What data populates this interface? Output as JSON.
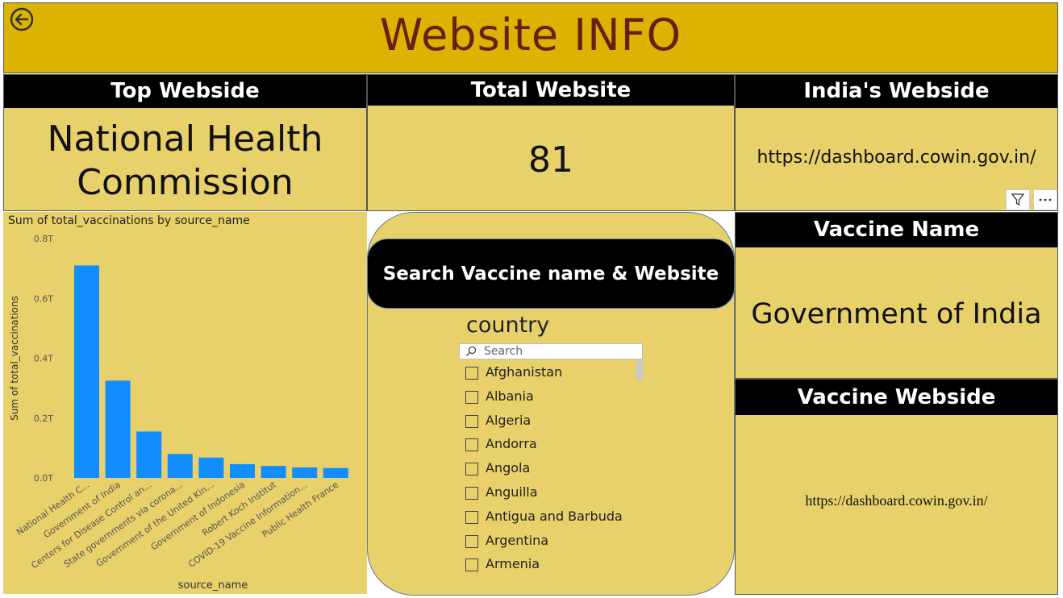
{
  "header": {
    "title": "Website INFO",
    "back_icon": "back-arrow-icon"
  },
  "cards": {
    "top_website": {
      "title": "Top Webside",
      "value_line1": "National Health",
      "value_line2": "Commission"
    },
    "total_website": {
      "title": "Total Website",
      "value": "81"
    },
    "india_website": {
      "title": "India's Webside",
      "value": "https://dashboard.cowin.gov.in/"
    },
    "vaccine_name": {
      "title": "Vaccine Name",
      "value": "Government of India"
    },
    "vaccine_website": {
      "title": "Vaccine Webside",
      "value": "https://dashboard.cowin.gov.in/"
    }
  },
  "toolbar": {
    "filter_icon": "filter-icon",
    "more_icon": "more-options-icon"
  },
  "search_panel": {
    "title": "Search Vaccine name & Website",
    "slicer_title": "country",
    "search_placeholder": "Search",
    "items": [
      "Afghanistan",
      "Albania",
      "Algeria",
      "Andorra",
      "Angola",
      "Anguilla",
      "Antigua and Barbuda",
      "Argentina",
      "Armenia"
    ]
  },
  "colors": {
    "banner": "#dbb300",
    "card": "#e8d06a",
    "bar": "#118dff",
    "title_text": "#6b1f14"
  },
  "chart_data": {
    "type": "bar",
    "title": "Sum of total_vaccinations by source_name",
    "xlabel": "source_name",
    "ylabel": "Sum of total_vaccinations",
    "ylim": [
      0,
      0.8
    ],
    "yticks": [
      0,
      0.2,
      0.4,
      0.6,
      0.8
    ],
    "ytick_labels": [
      "0.0T",
      "0.2T",
      "0.4T",
      "0.6T",
      "0.8T"
    ],
    "categories": [
      "National Health C...",
      "Government of India",
      "Centers for Disease Control an...",
      "State governments via corona...",
      "Government of the United Kin...",
      "Government of Indonesia",
      "Robert Koch Institut",
      "COVID-19 Vaccine Information...",
      "Public Health France"
    ],
    "values": [
      0.71,
      0.325,
      0.155,
      0.08,
      0.068,
      0.046,
      0.04,
      0.035,
      0.033
    ],
    "color": "#118dff",
    "grid": false,
    "legend": "none"
  }
}
